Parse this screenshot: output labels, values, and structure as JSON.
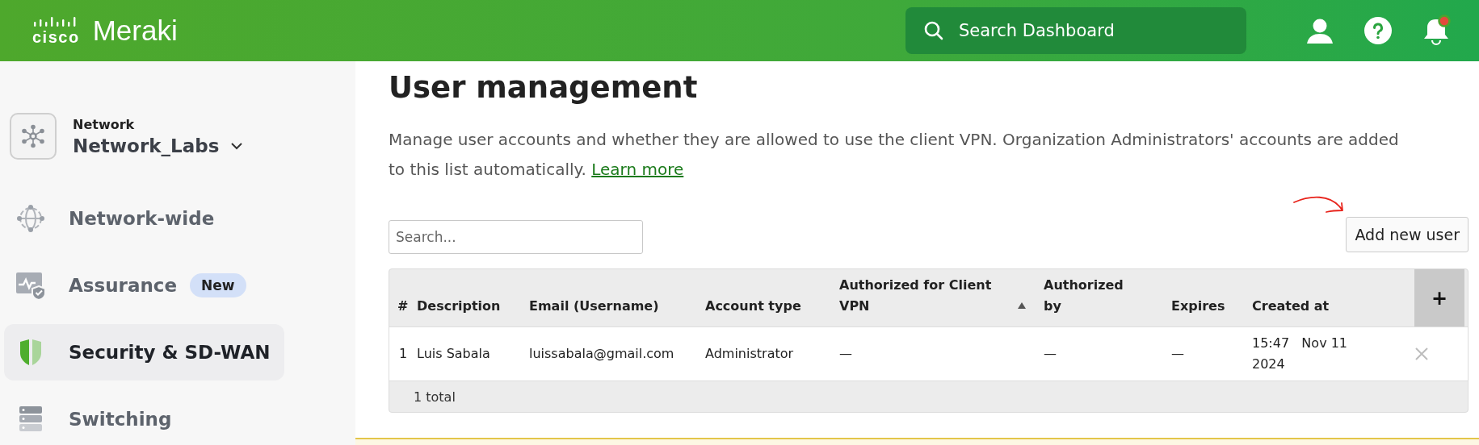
{
  "header": {
    "brand_mark": "cisco",
    "brand_name": "Meraki",
    "search": {
      "placeholder": "Search Dashboard"
    }
  },
  "network": {
    "label": "Network",
    "name": "Network_Labs"
  },
  "sidebar": {
    "items": [
      {
        "kind": "globe",
        "label": "Network-wide",
        "selected": false
      },
      {
        "kind": "assurance",
        "label": "Assurance",
        "badge": "New",
        "selected": false
      },
      {
        "kind": "shield",
        "label": "Security & SD-WAN",
        "selected": true
      },
      {
        "kind": "switch",
        "label": "Switching",
        "selected": false
      }
    ]
  },
  "page": {
    "title": "User management",
    "description": "Manage user accounts and whether they are allowed to use the client VPN. Organization Administrators' accounts are added to this list automatically.",
    "learn_more": "Learn more"
  },
  "search": {
    "placeholder": "Search..."
  },
  "add_button": "Add new user",
  "table": {
    "columns": [
      {
        "label": "#",
        "sorted": false
      },
      {
        "label": "Description",
        "sorted": false
      },
      {
        "label": "Email (Username)",
        "sorted": false
      },
      {
        "label": "Account type",
        "sorted": false
      },
      {
        "label": "Authorized for Client VPN",
        "sorted": true
      },
      {
        "label": "Authorized by",
        "sorted": false
      },
      {
        "label": "Expires",
        "sorted": false
      },
      {
        "label": "Created at",
        "sorted": false
      }
    ],
    "add_column": "+",
    "rows": [
      {
        "cells": [
          "1",
          "Luis Sabala",
          "luissabala@gmail.com",
          "Administrator",
          "—",
          "—",
          "—",
          "15:47   Nov 11 2024"
        ]
      }
    ],
    "footer": "1 total"
  }
}
